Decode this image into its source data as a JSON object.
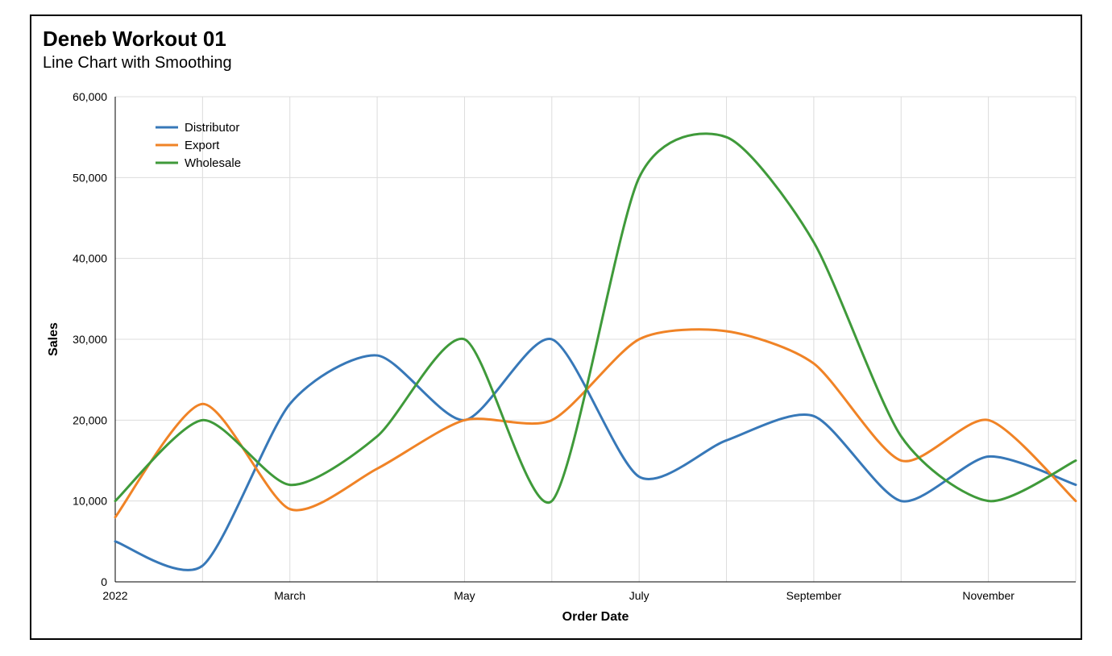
{
  "title": "Deneb Workout 01",
  "subtitle": "Line Chart with Smoothing",
  "xlabel": "Order Date",
  "ylabel": "Sales",
  "legend": {
    "items": [
      "Distributor",
      "Export",
      "Wholesale"
    ]
  },
  "x_ticks_visible": [
    "2022",
    "March",
    "May",
    "July",
    "September",
    "November"
  ],
  "y_ticks": [
    "0",
    "10,000",
    "20,000",
    "30,000",
    "40,000",
    "50,000",
    "60,000"
  ],
  "colors": {
    "Distributor": "#3778b8",
    "Export": "#f08326",
    "Wholesale": "#3f9a3a"
  },
  "chart_data": {
    "type": "line",
    "xlabel": "Order Date",
    "ylabel": "Sales",
    "title": "Deneb Workout 01",
    "subtitle": "Line Chart with Smoothing",
    "ylim": [
      0,
      60000
    ],
    "x": [
      "2022-01",
      "2022-02",
      "2022-03",
      "2022-04",
      "2022-05",
      "2022-06",
      "2022-07",
      "2022-08",
      "2022-09",
      "2022-10",
      "2022-11",
      "2022-12"
    ],
    "x_tick_labels": [
      "2022",
      "",
      "March",
      "",
      "May",
      "",
      "July",
      "",
      "September",
      "",
      "November",
      ""
    ],
    "series": [
      {
        "name": "Distributor",
        "color": "#3778b8",
        "values": [
          5000,
          2000,
          22000,
          28000,
          20000,
          30000,
          13000,
          17500,
          20500,
          10000,
          15500,
          12000
        ]
      },
      {
        "name": "Export",
        "color": "#f08326",
        "values": [
          8000,
          22000,
          9000,
          14000,
          20000,
          20000,
          30000,
          31000,
          27000,
          15000,
          20000,
          10000
        ]
      },
      {
        "name": "Wholesale",
        "color": "#3f9a3a",
        "values": [
          10000,
          20000,
          12000,
          18000,
          30000,
          10000,
          50000,
          55000,
          42000,
          18000,
          10000,
          15000
        ]
      }
    ],
    "legend_position": "top-left",
    "grid": true
  }
}
